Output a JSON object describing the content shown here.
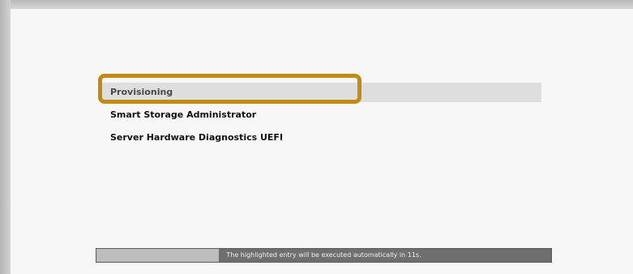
{
  "boot_menu": {
    "items": [
      {
        "label": "Provisioning",
        "selected": true
      },
      {
        "label": "Smart Storage Administrator",
        "selected": false
      },
      {
        "label": "Server Hardware Diagnostics UEFI",
        "selected": false
      }
    ],
    "highlight_color": "#c08b0f"
  },
  "status_bar": {
    "message": "The highlighted entry will be executed automatically in 11s.",
    "progress_percent": 27
  }
}
